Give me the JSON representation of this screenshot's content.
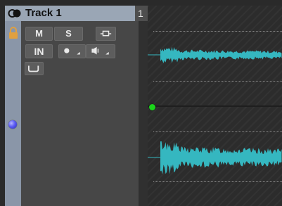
{
  "track": {
    "name": "Track 1",
    "number": "1"
  },
  "buttons": {
    "mute": "M",
    "solo": "S",
    "input": "IN"
  },
  "colors": {
    "header_bg": "#9aa6b5",
    "strip": "#8a96a8",
    "panel": "#474747",
    "waveform": "#35b7c0",
    "lock": "#e0a040",
    "cursor": "#1bd41b",
    "automation_dot": "#5b5bf4"
  },
  "icons": {
    "monitor": "monitor-toggle-icon",
    "lock": "lock-icon",
    "edit": "edit-envelope-icon",
    "record": "record-arm-icon",
    "speaker": "monitor-speaker-icon",
    "fx": "fx-insert-icon",
    "automation": "automation-dot-icon",
    "playhead": "playhead-icon"
  }
}
